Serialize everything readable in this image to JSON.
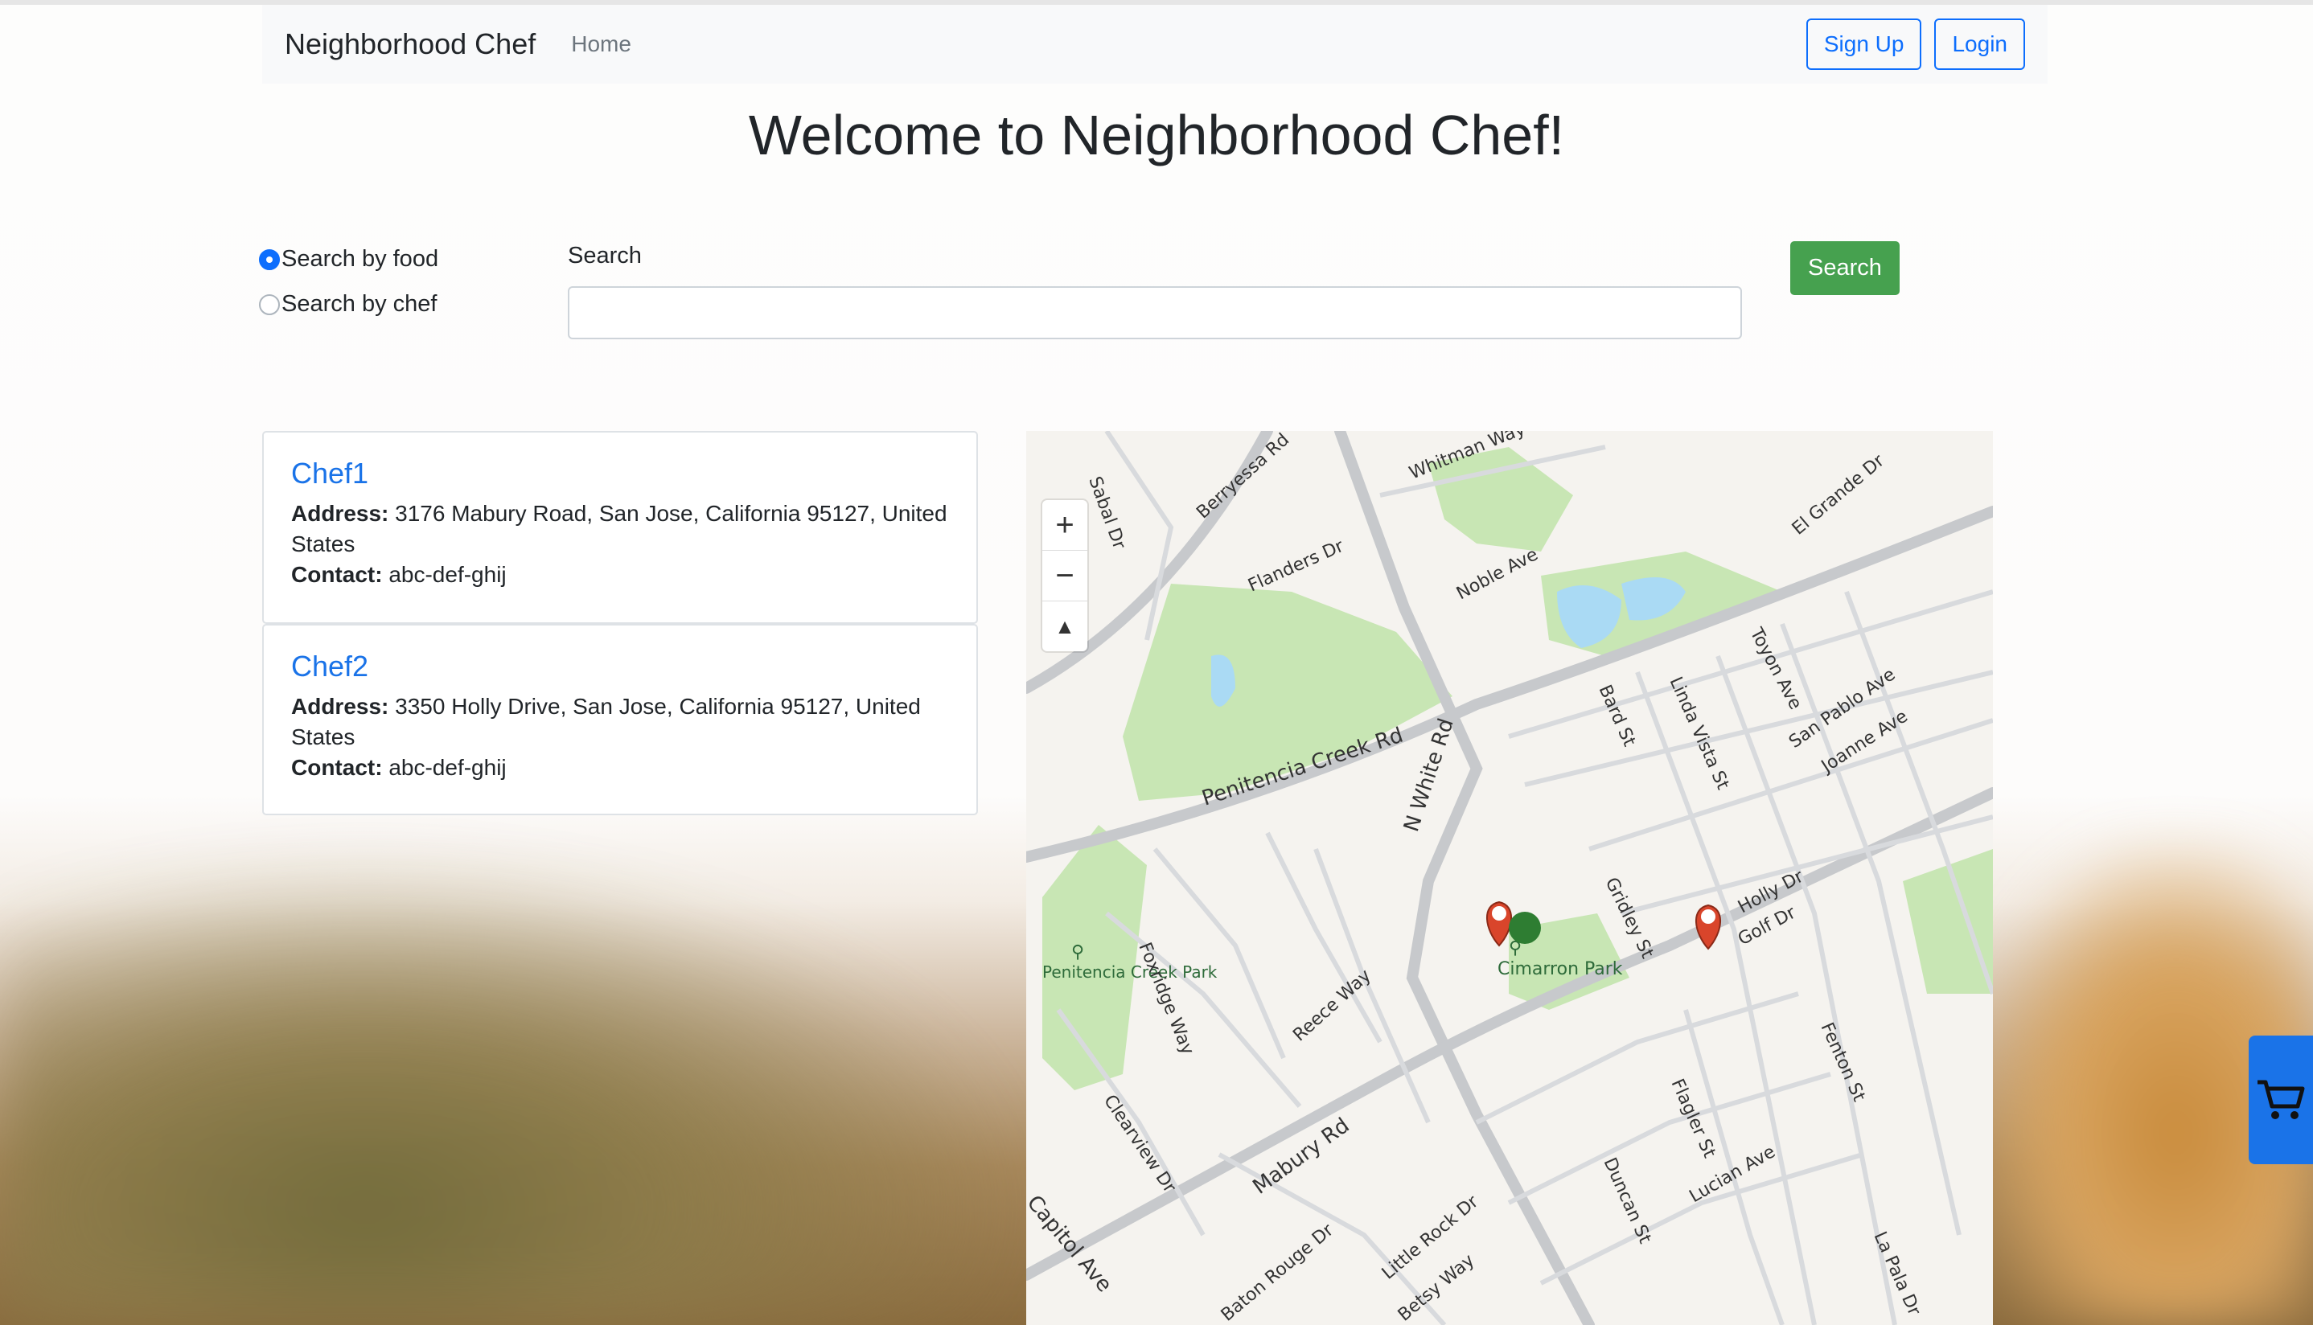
{
  "navbar": {
    "brand": "Neighborhood Chef",
    "home": "Home",
    "signup": "Sign Up",
    "login": "Login"
  },
  "page": {
    "title": "Welcome to Neighborhood Chef!"
  },
  "search": {
    "option_food": "Search by food",
    "option_chef": "Search by chef",
    "selected": "Search by food",
    "label": "Search",
    "value": "",
    "button": "Search"
  },
  "chefs": [
    {
      "name": "Chef1",
      "address_label": "Address:",
      "address": "3176 Mabury Road, San Jose, California 95127, United States",
      "contact_label": "Contact:",
      "contact": "abc-def-ghij"
    },
    {
      "name": "Chef2",
      "address_label": "Address:",
      "address": "3350 Holly Drive, San Jose, California 95127, United States",
      "contact_label": "Contact:",
      "contact": "abc-def-ghij"
    }
  ],
  "map": {
    "zoom_in": "+",
    "zoom_out": "−",
    "compass": "▲",
    "street_labels": [
      "Berryessa Rd",
      "Whitman Way",
      "Sabal Dr",
      "Flanders Dr",
      "Noble Ave",
      "El Grande Dr",
      "Toyon Ave",
      "San Pablo Ave",
      "Joanne Ave",
      "Bard St",
      "Linda Vista St",
      "Penitencia Creek Rd",
      "N White Rd",
      "Gridley St",
      "Holly Dr",
      "Golf Dr",
      "Cimarron Park",
      "Penitencia Creek Park",
      "Foxridge Way",
      "Reece Way",
      "Clearview Dr",
      "Mabury Rd",
      "Flagler St",
      "Fenton St",
      "Duncan St",
      "Lucian Ave",
      "Little Rock Dr",
      "Baton Rouge Dr",
      "Betsy Way",
      "La Pala Dr",
      "Capitol Ave"
    ]
  },
  "colors": {
    "accent": "#0d6efd",
    "search_button": "#46a14f",
    "chef_link": "#1a73e8",
    "marker": "#d9452b",
    "park": "#c8e6b4"
  },
  "icons": {
    "cart": "cart-icon"
  }
}
